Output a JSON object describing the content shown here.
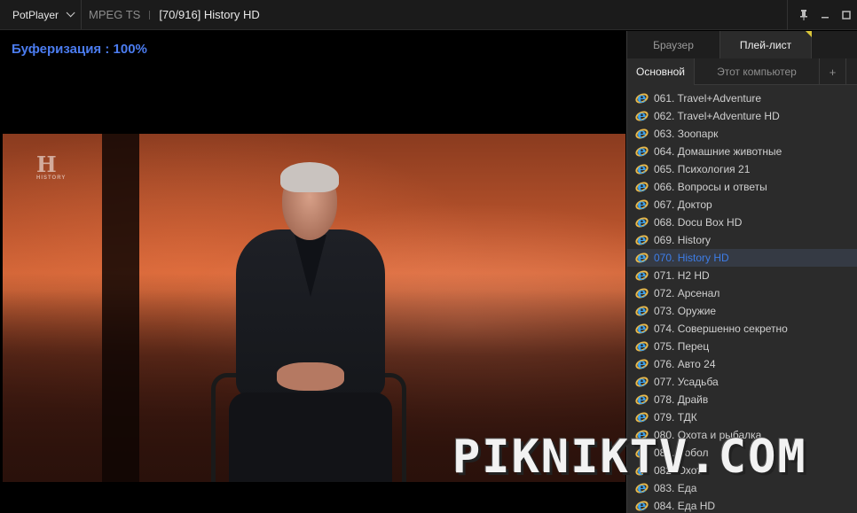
{
  "app": {
    "menu_label": "PotPlayer",
    "format": "MPEG TS",
    "title": "[70/916] History HD"
  },
  "window_controls": {
    "pin": "pin-icon",
    "minimize": "minimize-icon",
    "maximize": "maximize-icon"
  },
  "osd": {
    "text": "Буферизация : 100%"
  },
  "watermark": {
    "text": "PIKNIKTV.COM"
  },
  "panel": {
    "tabs": [
      {
        "label": "Браузер",
        "active": false
      },
      {
        "label": "Плей-лист",
        "active": true
      }
    ],
    "subtabs": [
      {
        "label": "Основной",
        "active": true
      },
      {
        "label": "Этот компьютер",
        "active": false
      },
      {
        "label": "+",
        "active": false
      }
    ],
    "items": [
      {
        "label": "061. Travel+Adventure"
      },
      {
        "label": "062. Travel+Adventure HD"
      },
      {
        "label": "063. Зоопарк"
      },
      {
        "label": "064. Домашние животные"
      },
      {
        "label": "065. Психология 21"
      },
      {
        "label": "066. Вопросы и ответы"
      },
      {
        "label": "067. Доктор"
      },
      {
        "label": "068. Docu Box HD"
      },
      {
        "label": "069. History"
      },
      {
        "label": "070. History HD",
        "current": true
      },
      {
        "label": "071. H2 HD"
      },
      {
        "label": "072. Арсенал"
      },
      {
        "label": "073. Оружие"
      },
      {
        "label": "074. Совершенно секретно"
      },
      {
        "label": "075. Перец"
      },
      {
        "label": "076. Авто 24"
      },
      {
        "label": "077. Усадьба"
      },
      {
        "label": "078. Драйв"
      },
      {
        "label": "079. ТДК"
      },
      {
        "label": "080. Охота и рыбалка"
      },
      {
        "label": "081. Бобол"
      },
      {
        "label": "082. Охота"
      },
      {
        "label": "083. Еда"
      },
      {
        "label": "084. Еда HD"
      }
    ]
  },
  "colors": {
    "accent": "#3d7de8",
    "osd": "#4b7cf0",
    "panel_bg": "#2b2b2b"
  }
}
